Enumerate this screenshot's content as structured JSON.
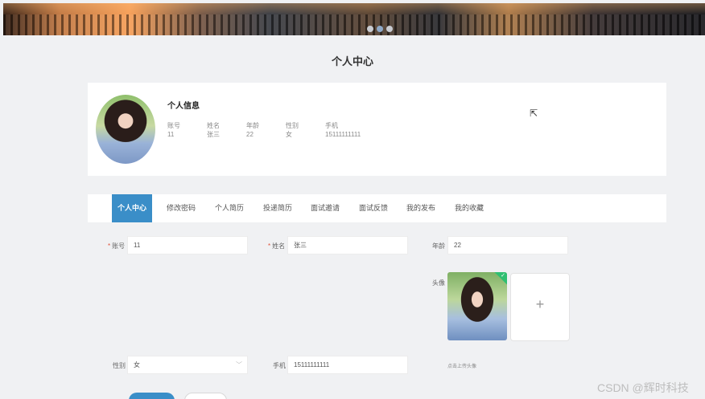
{
  "page_title": "个人中心",
  "profile": {
    "heading": "个人信息",
    "fields": [
      {
        "label": "账号",
        "value": "11"
      },
      {
        "label": "姓名",
        "value": "张三"
      },
      {
        "label": "年龄",
        "value": "22"
      },
      {
        "label": "性别",
        "value": "女"
      },
      {
        "label": "手机",
        "value": "15111111111"
      }
    ]
  },
  "tabs": [
    "个人中心",
    "修改密码",
    "个人简历",
    "投递简历",
    "面试邀请",
    "面试反馈",
    "我的发布",
    "我的收藏"
  ],
  "form": {
    "account_label": "账号",
    "account_value": "11",
    "name_label": "姓名",
    "name_value": "张三",
    "age_label": "年龄",
    "age_value": "22",
    "avatar_label": "头像",
    "gender_label": "性别",
    "gender_value": "女",
    "phone_label": "手机",
    "phone_value": "15111111111",
    "upload_tip": "点击上传头像",
    "required_mark": "*"
  },
  "icons": {
    "upload_plus": "+",
    "chevron": "﹀",
    "cursor": "⇱",
    "check": "✓"
  },
  "watermark": "CSDN @辉时科技",
  "colors": {
    "accent": "#3a8ec8",
    "success": "#2fbf71",
    "required": "#e0553e"
  }
}
